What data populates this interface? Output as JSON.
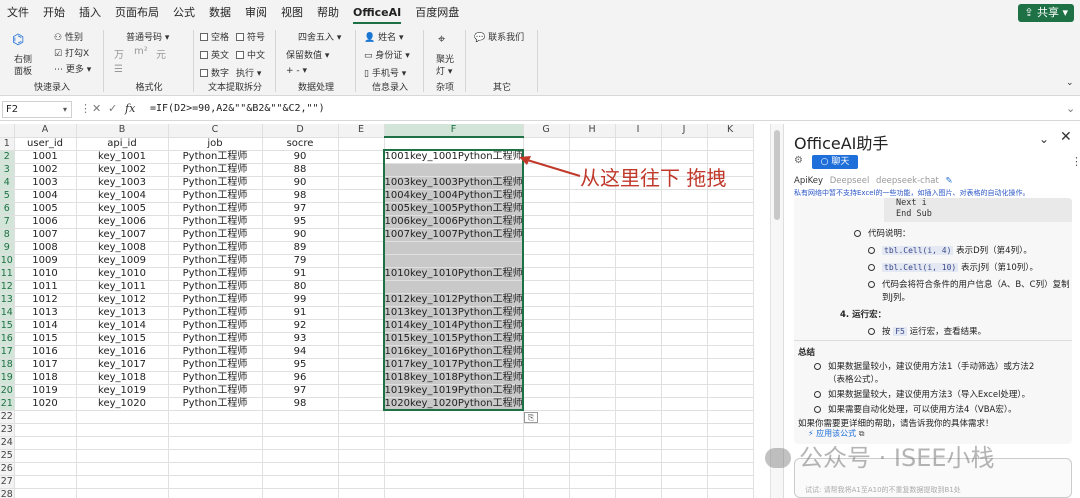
{
  "menubar": {
    "items": [
      "文件",
      "开始",
      "插入",
      "页面布局",
      "公式",
      "数据",
      "审阅",
      "视图",
      "帮助",
      "OfficeAI",
      "百度网盘"
    ],
    "active_index": 9,
    "share_label": "共享"
  },
  "ribbon": {
    "group1": {
      "btn_label": "右侧\n面板",
      "btn_line1": "右侧",
      "btn_line2": "面板",
      "items": [
        "性别",
        "打勾X",
        "更多"
      ],
      "label": "快速录入"
    },
    "group2": {
      "top": "普通号码",
      "row2": [
        "万",
        "m²",
        "元"
      ],
      "label": "格式化"
    },
    "group3": {
      "checks": [
        "空格",
        "符号",
        "英文",
        "中文",
        "数字"
      ],
      "extra": "执行",
      "label": "文本提取拆分"
    },
    "group4": {
      "top": "四舍五入",
      "row2": "保留数值",
      "row3": "+ -",
      "label": "数据处理"
    },
    "group5": {
      "items": [
        "姓名",
        "身份证",
        "手机号"
      ],
      "label": "信息录入"
    },
    "group6": {
      "top": "聚光",
      "top2": "灯",
      "label": "杂项"
    },
    "group7": {
      "top": "联系我们",
      "label": "其它"
    }
  },
  "formula_bar": {
    "name_box": "F2",
    "fx_label": "fx",
    "formula": "=IF(D2>=90,A2&\"\"&B2&\"\"&C2,\"\")"
  },
  "grid": {
    "columns": [
      "A",
      "B",
      "C",
      "D",
      "E",
      "F",
      "G",
      "H",
      "I",
      "J",
      "K"
    ],
    "selected_column": "F",
    "header_row": [
      "user_id",
      "api_id",
      "job",
      "socre",
      "",
      ""
    ],
    "rows": [
      [
        "1001",
        "key_1001",
        "Python工程师",
        "90",
        "",
        "1001key_1001Python工程师"
      ],
      [
        "1002",
        "key_1002",
        "Python工程师",
        "88",
        "",
        ""
      ],
      [
        "1003",
        "key_1003",
        "Python工程师",
        "90",
        "",
        "1003key_1003Python工程师"
      ],
      [
        "1004",
        "key_1004",
        "Python工程师",
        "98",
        "",
        "1004key_1004Python工程师"
      ],
      [
        "1005",
        "key_1005",
        "Python工程师",
        "97",
        "",
        "1005key_1005Python工程师"
      ],
      [
        "1006",
        "key_1006",
        "Python工程师",
        "95",
        "",
        "1006key_1006Python工程师"
      ],
      [
        "1007",
        "key_1007",
        "Python工程师",
        "90",
        "",
        "1007key_1007Python工程师"
      ],
      [
        "1008",
        "key_1008",
        "Python工程师",
        "89",
        "",
        ""
      ],
      [
        "1009",
        "key_1009",
        "Python工程师",
        "79",
        "",
        ""
      ],
      [
        "1010",
        "key_1010",
        "Python工程师",
        "91",
        "",
        "1010key_1010Python工程师"
      ],
      [
        "1011",
        "key_1011",
        "Python工程师",
        "80",
        "",
        ""
      ],
      [
        "1012",
        "key_1012",
        "Python工程师",
        "99",
        "",
        "1012key_1012Python工程师"
      ],
      [
        "1013",
        "key_1013",
        "Python工程师",
        "91",
        "",
        "1013key_1013Python工程师"
      ],
      [
        "1014",
        "key_1014",
        "Python工程师",
        "92",
        "",
        "1014key_1014Python工程师"
      ],
      [
        "1015",
        "key_1015",
        "Python工程师",
        "93",
        "",
        "1015key_1015Python工程师"
      ],
      [
        "1016",
        "key_1016",
        "Python工程师",
        "94",
        "",
        "1016key_1016Python工程师"
      ],
      [
        "1017",
        "key_1017",
        "Python工程师",
        "95",
        "",
        "1017key_1017Python工程师"
      ],
      [
        "1018",
        "key_1018",
        "Python工程师",
        "96",
        "",
        "1018key_1018Python工程师"
      ],
      [
        "1019",
        "key_1019",
        "Python工程师",
        "97",
        "",
        "1019key_1019Python工程师"
      ],
      [
        "1020",
        "key_1020",
        "Python工程师",
        "98",
        "",
        "1020key_1020Python工程师"
      ]
    ],
    "row_numbers": [
      "1",
      "2",
      "3",
      "4",
      "5",
      "6",
      "7",
      "8",
      "9",
      "10",
      "11",
      "12",
      "13",
      "14",
      "15",
      "16",
      "17",
      "18",
      "19",
      "20",
      "21",
      "22",
      "23",
      "24",
      "25",
      "26",
      "27",
      "28"
    ],
    "selection_color": "#1e7145"
  },
  "annotation": {
    "text": "从这里往下 拖拽",
    "color": "#c0392b"
  },
  "side_panel": {
    "title": "OfficeAI助手",
    "chat_tab": "聊天",
    "apikey_label": "ApiKey",
    "model_options": [
      "Deepseel",
      "deepseek-chat"
    ],
    "warning": "私有网络中暂不支持Excel的一些功能，如插入图片、对表格的自动化操作。",
    "code_lines": [
      "Next i",
      "End Sub"
    ],
    "lines": {
      "code_desc": "代码说明：",
      "b1_code": "tbl.Cell(i, 4)",
      "b1_text": "表示D列（第4列）。",
      "b2_code": "tbl.Cell(i, 10)",
      "b2_text": "表示J列（第10列）。",
      "b3_text1": "代码会将符合条件的用户信息（A、B、C列）复制",
      "b3_text2": "到J列。",
      "step4_num": "4.",
      "step4_title": "运行宏：",
      "b4_pre": "按",
      "b4_code": "F5",
      "b4_post": "运行宏，查看结果。",
      "summary_title": "总结",
      "s1_1": "如果数据量较小，建议使用方法1（手动筛选）或方法2",
      "s1_2": "（表格公式）。",
      "s2": "如果数据量较大，建议使用方法3（导入Excel处理）。",
      "s3": "如果需要自动化处理，可以使用方法4（VBA宏）。",
      "closing": "如果你需要更详细的帮助，请告诉我你的具体需求！"
    },
    "apply_label": "应用该公式",
    "input_placeholder": "试试: 请帮我将A1至A10的不重复数据提取到B1处"
  },
  "watermark": {
    "text": "公众号 · ISEE小栈"
  }
}
